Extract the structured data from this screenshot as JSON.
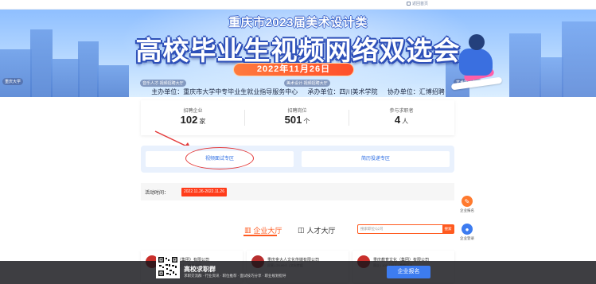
{
  "topbar": {
    "portal_label": "返回首页"
  },
  "banner": {
    "title_small": "重庆市2023届美术设计类",
    "title_big": "高校毕业生视频网络双选会",
    "date": "2022年11月26日",
    "tags": [
      "重庆大学",
      "音乐人才·视频招聘大厅",
      "美术设计·视频招聘大厅",
      "艺术展示大厅"
    ],
    "hosts": {
      "organizer": "主办单位：重庆市大学中专毕业生就业指导服务中心",
      "undertaker": "承办单位：四川美术学院",
      "co_organizer": "协办单位：汇博招聘"
    }
  },
  "stats": [
    {
      "label": "招聘企业",
      "value": "102",
      "unit": "家"
    },
    {
      "label": "招聘岗位",
      "value": "501",
      "unit": "个"
    },
    {
      "label": "参与求职者",
      "value": "4",
      "unit": "人"
    }
  ],
  "zones": {
    "video": "视频面试专区",
    "resume": "简历投递专区"
  },
  "activity": {
    "label": "活动时间：",
    "value": "2022.11.26-2022.11.26"
  },
  "floaters": [
    {
      "label": "企业报名",
      "color": "#ff7a2e"
    },
    {
      "label": "企业登录",
      "color": "#3d7cf0"
    }
  ],
  "tabs": {
    "company": "企业大厅",
    "talent": "人才大厅"
  },
  "search": {
    "placeholder": "搜索职位/公司",
    "button": "搜索"
  },
  "cards": [
    {
      "name": "重庆港务（集团）有限公司",
      "tags": "国企 | 500人以上 | 物流/运输"
    },
    {
      "name": "重庆金大人文化传媒有限公司",
      "tags": "民营 | 20-99人 | 文化传媒"
    },
    {
      "name": "重庆教育文化（集团）有限公司",
      "tags": "国企 | 100-499人 | 教育培训"
    }
  ],
  "bottombar": {
    "title": "高校求职群",
    "subtitle": "求职交流群 · 行业资讯 · 职位推荐 · 面试技巧分享 · 职业规划指导",
    "enroll": "企业报名"
  }
}
